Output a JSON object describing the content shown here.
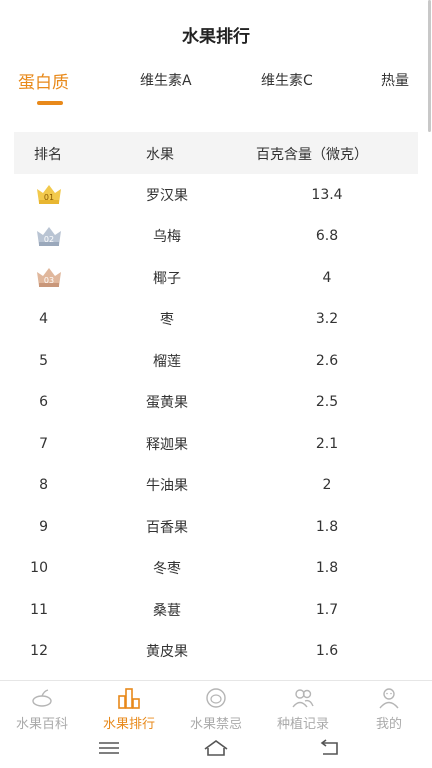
{
  "header": {
    "title": "水果排行"
  },
  "tabs": [
    {
      "label": "蛋白质",
      "active": true
    },
    {
      "label": "维生素A",
      "active": false
    },
    {
      "label": "维生素C",
      "active": false
    },
    {
      "label": "热量",
      "active": false
    }
  ],
  "table": {
    "headers": {
      "rank": "排名",
      "fruit": "水果",
      "value": "百克含量（微克）"
    },
    "rows": [
      {
        "rank": "01",
        "fruit": "罗汉果",
        "value": "13.4",
        "medal": "gold"
      },
      {
        "rank": "02",
        "fruit": "乌梅",
        "value": "6.8",
        "medal": "silver"
      },
      {
        "rank": "03",
        "fruit": "椰子",
        "value": "4",
        "medal": "bronze"
      },
      {
        "rank": "4",
        "fruit": "枣",
        "value": "3.2"
      },
      {
        "rank": "5",
        "fruit": "榴莲",
        "value": "2.6"
      },
      {
        "rank": "6",
        "fruit": "蛋黄果",
        "value": "2.5"
      },
      {
        "rank": "7",
        "fruit": "释迦果",
        "value": "2.1"
      },
      {
        "rank": "8",
        "fruit": "牛油果",
        "value": "2"
      },
      {
        "rank": "9",
        "fruit": "百香果",
        "value": "1.8"
      },
      {
        "rank": "10",
        "fruit": "冬枣",
        "value": "1.8"
      },
      {
        "rank": "11",
        "fruit": "桑葚",
        "value": "1.7"
      },
      {
        "rank": "12",
        "fruit": "黄皮果",
        "value": "1.6"
      }
    ]
  },
  "bottom_nav": [
    {
      "label": "水果百科",
      "icon": "fruit-encyclopedia-icon",
      "active": false
    },
    {
      "label": "水果排行",
      "icon": "ranking-icon",
      "active": true
    },
    {
      "label": "水果禁忌",
      "icon": "taboo-icon",
      "active": false
    },
    {
      "label": "种植记录",
      "icon": "planting-record-icon",
      "active": false
    },
    {
      "label": "我的",
      "icon": "profile-icon",
      "active": false
    }
  ],
  "colors": {
    "accent": "#e8891a",
    "inactive": "#aaaaaa",
    "gold": "#f2c94c",
    "silver": "#a9b7c9",
    "bronze": "#d9a98a"
  }
}
